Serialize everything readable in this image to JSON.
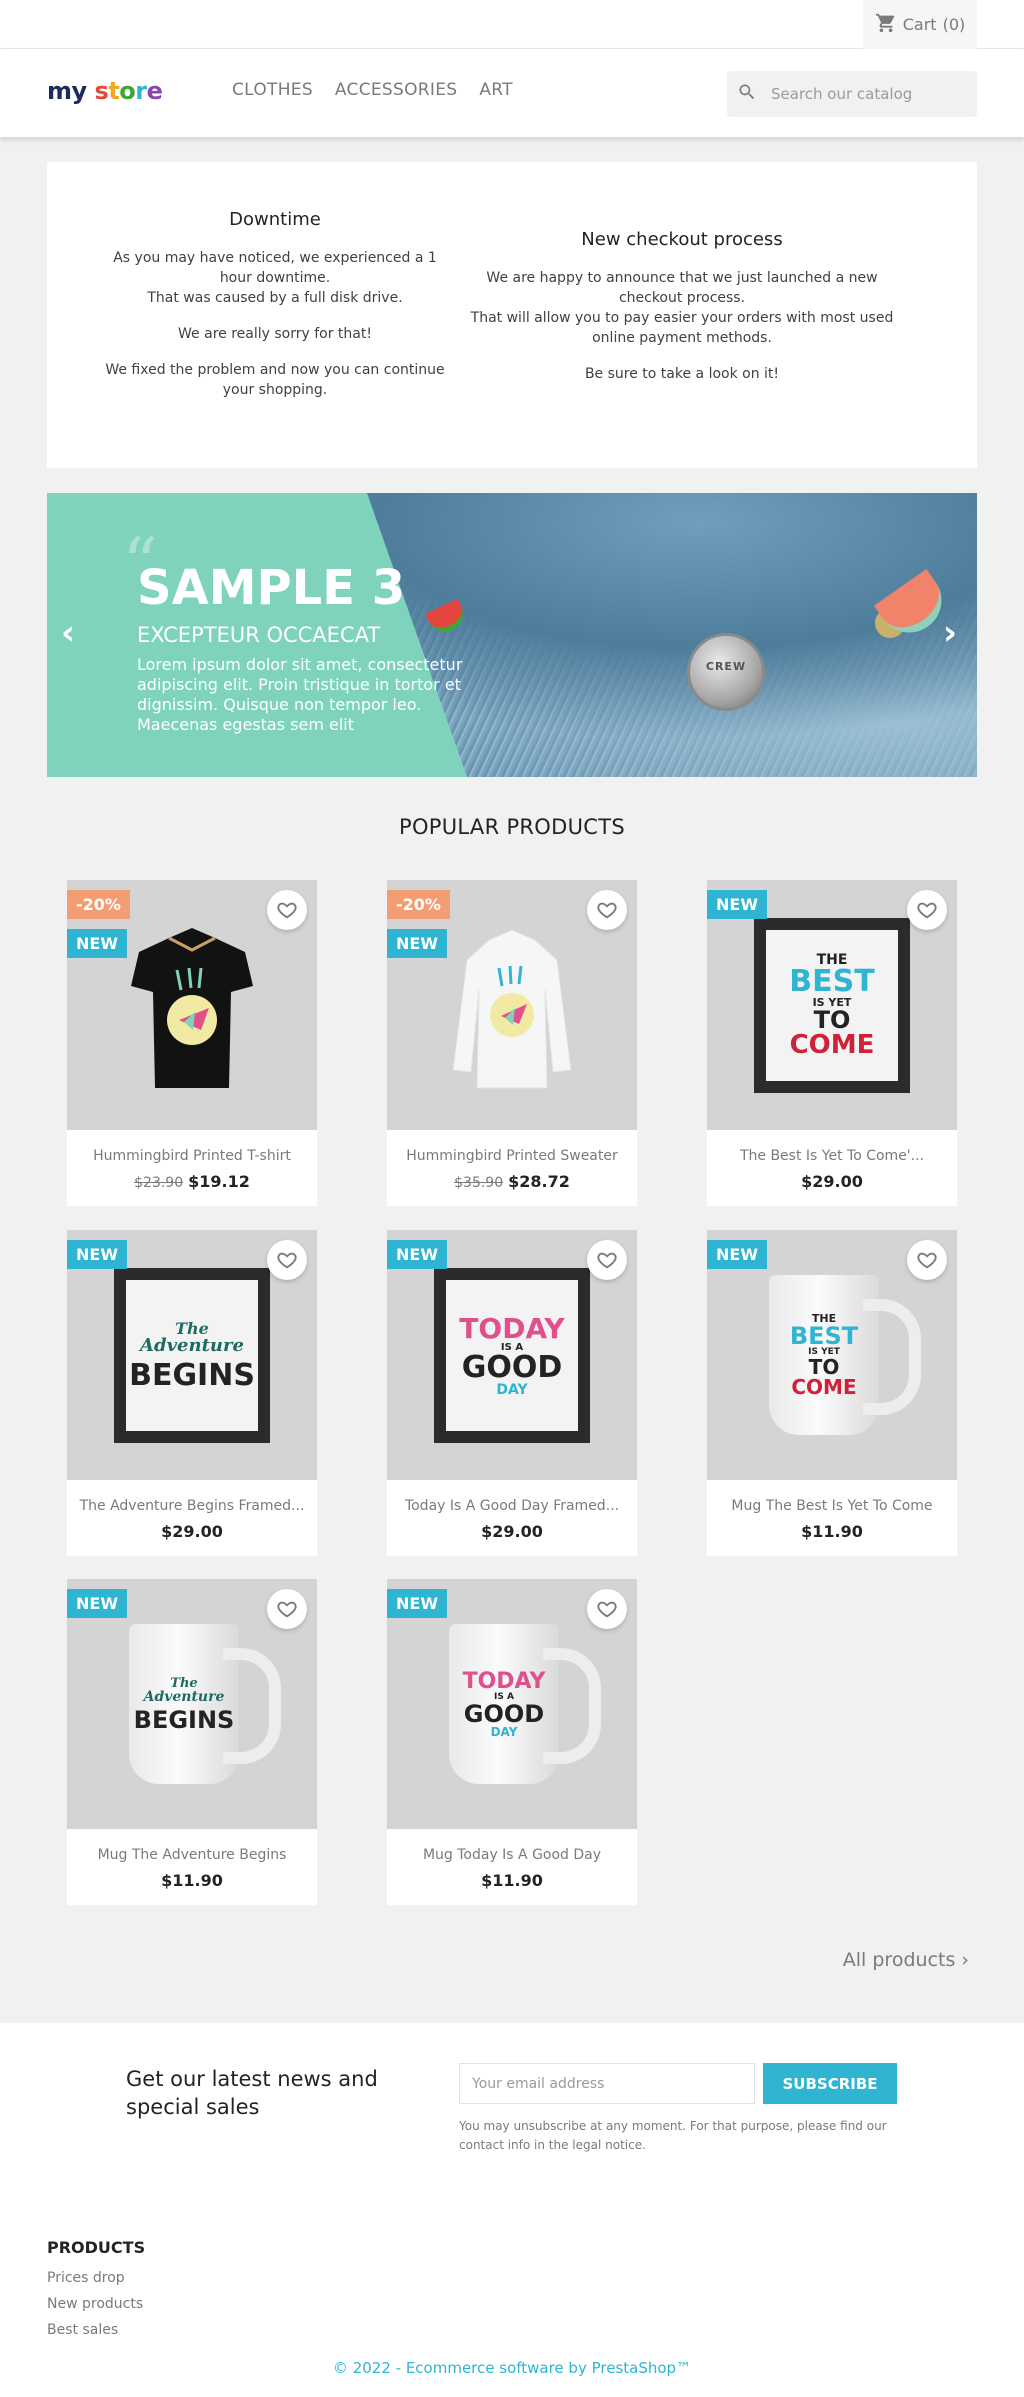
{
  "top_bar": {
    "cart_label": "Cart",
    "cart_count": "(0)"
  },
  "header": {
    "logo_my": "my",
    "logo_store": "store",
    "nav": [
      "CLOTHES",
      "ACCESSORIES",
      "ART"
    ],
    "search_placeholder": "Search our catalog"
  },
  "custom_text": {
    "left": {
      "title": "Downtime",
      "p1": "As you may have noticed, we experienced a 1 hour downtime.",
      "p1b": "That was caused by a full disk drive.",
      "p2": "We are really sorry for that!",
      "p3": "We fixed the problem and now you can continue your shopping."
    },
    "right": {
      "title": "New checkout process",
      "p1": "We are happy to announce that we just launched a new checkout process.",
      "p1b": "That will allow you to pay easier your orders with most used online payment methods.",
      "p2": "Be sure to take a look on it!"
    }
  },
  "slider": {
    "quote": "“",
    "title": "SAMPLE 3",
    "subtitle": "EXCEPTEUR OCCAECAT",
    "description": "Lorem ipsum dolor sit amet, consectetur adipiscing elit. Proin tristique in tortor et dignissim. Quisque non tempor leo. Maecenas egestas sem elit",
    "prev": "‹",
    "next": "›",
    "pin_text": "CREW"
  },
  "section_title": "POPULAR PRODUCTS",
  "products": [
    {
      "name": "Hummingbird Printed T-shirt",
      "old_price": "$23.90",
      "price": "$19.12",
      "discount": "-20%",
      "flag": "NEW"
    },
    {
      "name": "Hummingbird Printed Sweater",
      "old_price": "$35.90",
      "price": "$28.72",
      "discount": "-20%",
      "flag": "NEW"
    },
    {
      "name": "The Best Is Yet To Come'...",
      "price": "$29.00",
      "flag": "NEW"
    },
    {
      "name": "The Adventure Begins Framed...",
      "price": "$29.00",
      "flag": "NEW"
    },
    {
      "name": "Today Is A Good Day Framed...",
      "price": "$29.00",
      "flag": "NEW"
    },
    {
      "name": "Mug The Best Is Yet To Come",
      "price": "$11.90",
      "flag": "NEW"
    },
    {
      "name": "Mug The Adventure Begins",
      "price": "$11.90",
      "flag": "NEW"
    },
    {
      "name": "Mug Today Is A Good Day",
      "price": "$11.90",
      "flag": "NEW"
    }
  ],
  "artwork": {
    "best": [
      "THE",
      "BEST",
      "IS YET",
      "TO",
      "COME"
    ],
    "adventure": [
      "The",
      "Adventure",
      "BEGINS"
    ],
    "today": [
      "TODAY",
      "IS A",
      "GOOD",
      "DAY"
    ]
  },
  "all_products": "All products",
  "newsletter": {
    "title": "Get our latest news and special sales",
    "email_placeholder": "Your email address",
    "subscribe": "SUBSCRIBE",
    "note": "You may unsubscribe at any moment. For that purpose, please find our contact info in the legal notice."
  },
  "footer": {
    "heading": "PRODUCTS",
    "links": [
      "Prices drop",
      "New products",
      "Best sales"
    ],
    "copyright": "© 2022 - Ecommerce software by PrestaShop™"
  },
  "colors": {
    "accent": "#2fb5d2",
    "discount": "#f39d72",
    "mint": "#7fd3bd"
  },
  "icons": [
    "cart-icon",
    "search-icon",
    "heart-icon",
    "chevron-left-icon",
    "chevron-right-icon"
  ]
}
